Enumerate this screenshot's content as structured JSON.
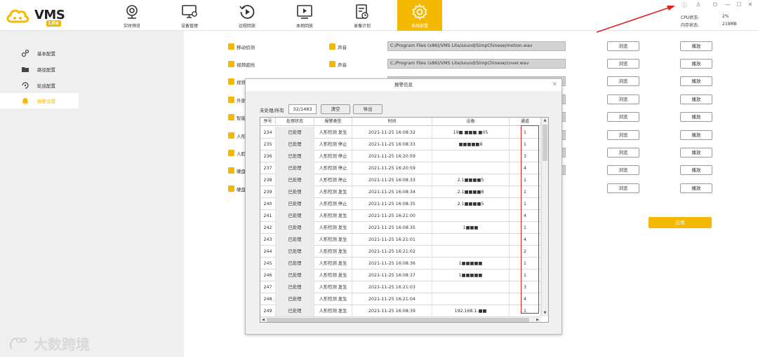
{
  "app": {
    "logo_text": "VMS",
    "logo_badge": "Lite"
  },
  "nav": [
    {
      "label": "实时预览",
      "icon": "webcam-icon"
    },
    {
      "label": "设备管理",
      "icon": "monitor-settings-icon"
    },
    {
      "label": "远程回放",
      "icon": "replay-icon"
    },
    {
      "label": "本地回放",
      "icon": "play-screen-icon"
    },
    {
      "label": "录像计划",
      "icon": "schedule-icon"
    },
    {
      "label": "系统配置",
      "icon": "gear-icon"
    }
  ],
  "system": {
    "cpu_label": "CPU状态:",
    "cpu_value": "2%",
    "mem_label": "内存状态:",
    "mem_value": "219MB"
  },
  "sidebar": [
    {
      "label": "基本配置",
      "icon": "gears-icon"
    },
    {
      "label": "路径配置",
      "icon": "folder-icon"
    },
    {
      "label": "轮巡配置",
      "icon": "cycle-icon"
    },
    {
      "label": "报警设置",
      "icon": "bell-icon"
    }
  ],
  "content": {
    "rows": [
      {
        "label": "移动侦测",
        "sound_label": "声音",
        "path": "C:/Program Files (x86)/VMS Lite/sound/SimpChinese/motion.wav"
      },
      {
        "label": "视频遮挡",
        "sound_label": "声音",
        "path": "C:/Program Files (x86)/VMS Lite/sound/SimpChinese/cover.wav"
      },
      {
        "label": "视频"
      },
      {
        "label": "外部"
      },
      {
        "label": "智能"
      },
      {
        "label": "人形"
      },
      {
        "label": "人脸"
      },
      {
        "label": "硬盘"
      },
      {
        "label": "硬盘"
      }
    ],
    "browse_label": "浏览",
    "play_label": "播放",
    "apply_label": "应用"
  },
  "dialog": {
    "title": "报警信息",
    "count_label": "未处理/所有",
    "count_value": "32/1483",
    "clear_label": "清空",
    "export_label": "导出",
    "columns": [
      "序号",
      "处理状态",
      "报警类型",
      "时间",
      "设备",
      "通道"
    ],
    "rows": [
      {
        "no": "234",
        "state": "已处理",
        "type": "人形检测 发生",
        "time": "2021-11-25 16:08:32",
        "device": "19■.■■■.■05",
        "channel": "1"
      },
      {
        "no": "235",
        "state": "已处理",
        "type": "人形检测 停止",
        "time": "2021-11-25 16:08:33",
        "device": "■■■■■8",
        "channel": "1"
      },
      {
        "no": "236",
        "state": "已处理",
        "type": "人形检测 停止",
        "time": "2021-11-25 16:20:59",
        "device": "",
        "channel": "3"
      },
      {
        "no": "237",
        "state": "已处理",
        "type": "人形检测 停止",
        "time": "2021-11-25 16:20:59",
        "device": "",
        "channel": "4"
      },
      {
        "no": "238",
        "state": "已处理",
        "type": "人形检测 停止",
        "time": "2021-11-25 16:08:33",
        "device": "2.1■■■■5",
        "channel": "1"
      },
      {
        "no": "239",
        "state": "已处理",
        "type": "人形检测 发生",
        "time": "2021-11-25 16:08:34",
        "device": "2.1■■■■8",
        "channel": "1"
      },
      {
        "no": "240",
        "state": "已处理",
        "type": "人形检测 停止",
        "time": "2021-11-25 16:08:35",
        "device": "2.1■■■■5",
        "channel": "1"
      },
      {
        "no": "241",
        "state": "已处理",
        "type": "人形检测 发生",
        "time": "2021-11-25 16:21:00",
        "device": "",
        "channel": "4"
      },
      {
        "no": "242",
        "state": "已处理",
        "type": "人形检测 发生",
        "time": "2021-11-25 16:08:35",
        "device": "1■■■",
        "channel": "1"
      },
      {
        "no": "243",
        "state": "已处理",
        "type": "人形检测 发生",
        "time": "2021-11-25 16:21:01",
        "device": "",
        "channel": "4"
      },
      {
        "no": "244",
        "state": "已处理",
        "type": "人形检测 发生",
        "time": "2021-11-25 16:21:02",
        "device": "",
        "channel": "2"
      },
      {
        "no": "245",
        "state": "已处理",
        "type": "人形检测 发生",
        "time": "2021-11-25 16:08:36",
        "device": "1■■■■■",
        "channel": "1"
      },
      {
        "no": "246",
        "state": "已处理",
        "type": "人形检测 发生",
        "time": "2021-11-25 16:08:37",
        "device": "1■■■■■",
        "channel": "1"
      },
      {
        "no": "247",
        "state": "已处理",
        "type": "人形检测 发生",
        "time": "2021-11-25 16:21:03",
        "device": "",
        "channel": "3"
      },
      {
        "no": "248",
        "state": "已处理",
        "type": "人形检测 发生",
        "time": "2021-11-25 16:21:04",
        "device": "",
        "channel": "4"
      },
      {
        "no": "249",
        "state": "已处理",
        "type": "人形检测 发生",
        "time": "2021-11-25 16:08:39",
        "device": "192.168.1.■■",
        "channel": "1"
      }
    ]
  },
  "watermark": {
    "text": "大数跨境"
  },
  "colors": {
    "accent": "#f5b800",
    "annotation": "#e02020"
  }
}
